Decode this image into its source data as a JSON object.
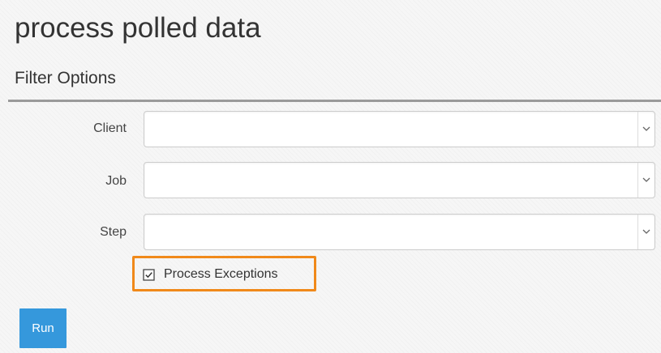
{
  "page": {
    "title": "process polled data"
  },
  "filter_section": {
    "title": "Filter Options",
    "fields": [
      {
        "label": "Client",
        "value": "",
        "icon": "chevron-down-icon"
      },
      {
        "label": "Job",
        "value": "",
        "icon": "chevron-down-icon"
      },
      {
        "label": "Step",
        "value": "",
        "icon": "chevron-down-icon"
      }
    ],
    "process_exceptions": {
      "label": "Process Exceptions",
      "checked": true,
      "highlight_color": "#f0891a"
    }
  },
  "actions": {
    "run_label": "Run",
    "run_color": "#3598dc"
  }
}
